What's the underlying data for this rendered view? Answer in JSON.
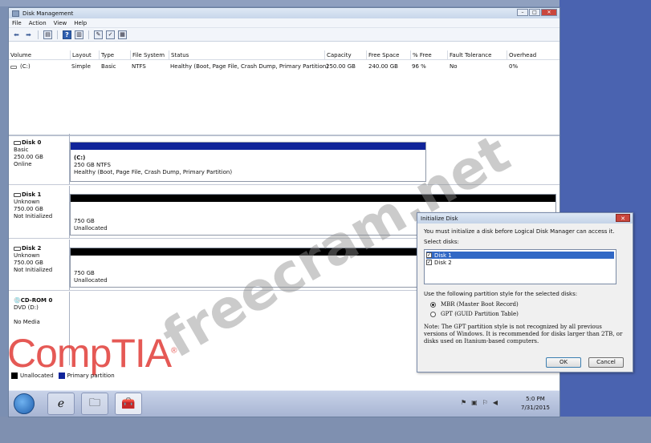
{
  "window": {
    "title": "Disk Management",
    "controls": [
      "–",
      "□",
      "✕"
    ]
  },
  "menu": [
    "File",
    "Action",
    "View",
    "Help"
  ],
  "volume_table": {
    "columns": [
      "Volume",
      "Layout",
      "Type",
      "File System",
      "Status",
      "Capacity",
      "Free Space",
      "% Free",
      "Fault Tolerance",
      "Overhead"
    ],
    "rows": [
      [
        "(C:)",
        "Simple",
        "Basic",
        "NTFS",
        "Healthy (Boot, Page File, Crash Dump, Primary Partition)",
        "250.00 GB",
        "240.00 GB",
        "96 %",
        "No",
        "0%"
      ]
    ]
  },
  "disks": [
    {
      "name": "Disk 0",
      "type": "Basic",
      "size": "250.00 GB",
      "state": "Online",
      "partition": {
        "title": "(C:)",
        "line1": "250 GB NTFS",
        "line2": "Healthy (Boot, Page File, Crash Dump, Primary Partition)"
      }
    },
    {
      "name": "Disk 1",
      "type": "Unknown",
      "size": "750.00 GB",
      "state": "Not Initialized",
      "partition": {
        "line1": "750 GB",
        "line2": "Unallocated"
      }
    },
    {
      "name": "Disk 2",
      "type": "Unknown",
      "size": "750.00 GB",
      "state": "Not Initialized",
      "partition": {
        "line1": "750 GB",
        "line2": "Unallocated"
      }
    },
    {
      "name": "CD-ROM 0",
      "type": "DVD (D:)",
      "size": "",
      "state": "No Media"
    }
  ],
  "legend": {
    "unallocated": "Unallocated",
    "primary": "Primary partition",
    "unallocated_color": "#000000",
    "primary_color": "#10249a"
  },
  "watermark": {
    "text": "freecram.net",
    "brand": "CompTIA",
    "brand_mark": "®"
  },
  "dialog": {
    "title": "Initialize Disk",
    "intro": "You must initialize a disk before Logical Disk Manager can access it.",
    "select_label": "Select disks:",
    "disks": [
      "Disk 1",
      "Disk 2"
    ],
    "style_label": "Use the following partition style for the selected disks:",
    "options": [
      "MBR (Master Boot Record)",
      "GPT (GUID Partition Table)"
    ],
    "note": "Note: The GPT partition style is not recognized by all previous versions of Windows. It is recommended for disks larger than 2TB, or disks used on Itanium-based computers.",
    "ok": "OK",
    "cancel": "Cancel"
  },
  "taskbar": {
    "time": "5:0 PM",
    "date": "7/31/2015"
  }
}
